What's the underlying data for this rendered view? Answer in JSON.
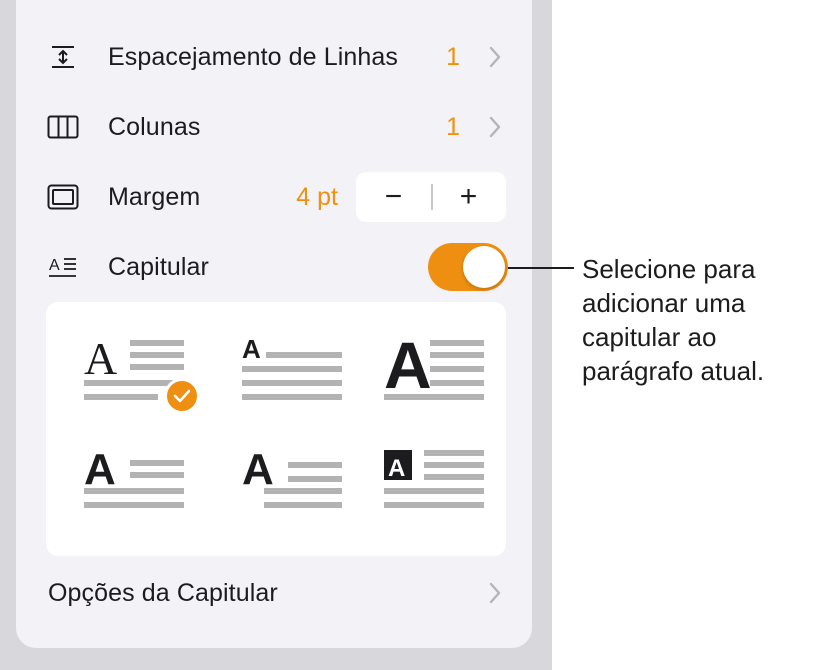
{
  "rows": {
    "line_spacing": {
      "label": "Espacejamento de Linhas",
      "value": "1",
      "icon": "line-spacing-icon"
    },
    "columns": {
      "label": "Colunas",
      "value": "1",
      "icon": "columns-icon"
    },
    "margin": {
      "label": "Margem",
      "value": "4 pt",
      "icon": "margin-icon",
      "decrement": "−",
      "increment": "+"
    },
    "drop_cap": {
      "label": "Capitular",
      "icon": "drop-cap-icon",
      "enabled": true
    }
  },
  "drop_cap_styles": [
    {
      "name": "serif-drop-cap",
      "letter": "A",
      "selected": true
    },
    {
      "name": "small-raised-cap",
      "letter": "A",
      "selected": false
    },
    {
      "name": "large-bold-cap",
      "letter": "A",
      "selected": false
    },
    {
      "name": "bold-drop-cap",
      "letter": "A",
      "selected": false
    },
    {
      "name": "bold-inline-cap",
      "letter": "A",
      "selected": false
    },
    {
      "name": "boxed-drop-cap",
      "letter": "A",
      "selected": false
    }
  ],
  "options": {
    "label": "Opções da Capitular"
  },
  "callout": {
    "text": "Selecione para\nadicionar uma\ncapitular ao\nparágrafo atual."
  },
  "colors": {
    "accent": "#ef8f11",
    "value_text": "#f0900c",
    "panel_bg": "#f2f2f7"
  }
}
